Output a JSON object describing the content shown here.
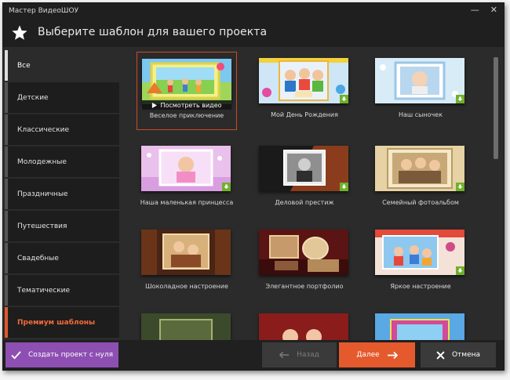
{
  "window": {
    "title": "Мастер ВидеоШОУ",
    "minimize": "—",
    "close": "✕"
  },
  "header": {
    "title": "Выберите шаблон для вашего проекта",
    "icon": "star-icon"
  },
  "sidebar": {
    "items": [
      {
        "label": "Все",
        "active": true
      },
      {
        "label": "Детские"
      },
      {
        "label": "Классические"
      },
      {
        "label": "Молодежные"
      },
      {
        "label": "Праздничные"
      },
      {
        "label": "Путешествия"
      },
      {
        "label": "Свадебные"
      },
      {
        "label": "Тематические"
      },
      {
        "label": "Премиум шаблоны",
        "accent": "#f26a3b"
      }
    ]
  },
  "templates": [
    {
      "label": "Веселое приключение",
      "selected": true,
      "preview_label": "Посмотреть видео"
    },
    {
      "label": "Мой День Рождения"
    },
    {
      "label": "Наш сыночек"
    },
    {
      "label": "Наша маленькая принцесса"
    },
    {
      "label": "Деловой престиж"
    },
    {
      "label": "Семейный фотоальбом"
    },
    {
      "label": "Шоколадное настроение"
    },
    {
      "label": "Элегантное портфолио"
    },
    {
      "label": "Яркое настроение"
    }
  ],
  "footer": {
    "create": "Создать проект с нуля",
    "back": "Назад",
    "next": "Далее",
    "cancel": "Отмена"
  },
  "colors": {
    "accent": "#e45a2d",
    "create_button": "#8e4fb3",
    "download_badge": "#6fb12a",
    "background": "#2b2b2b"
  }
}
